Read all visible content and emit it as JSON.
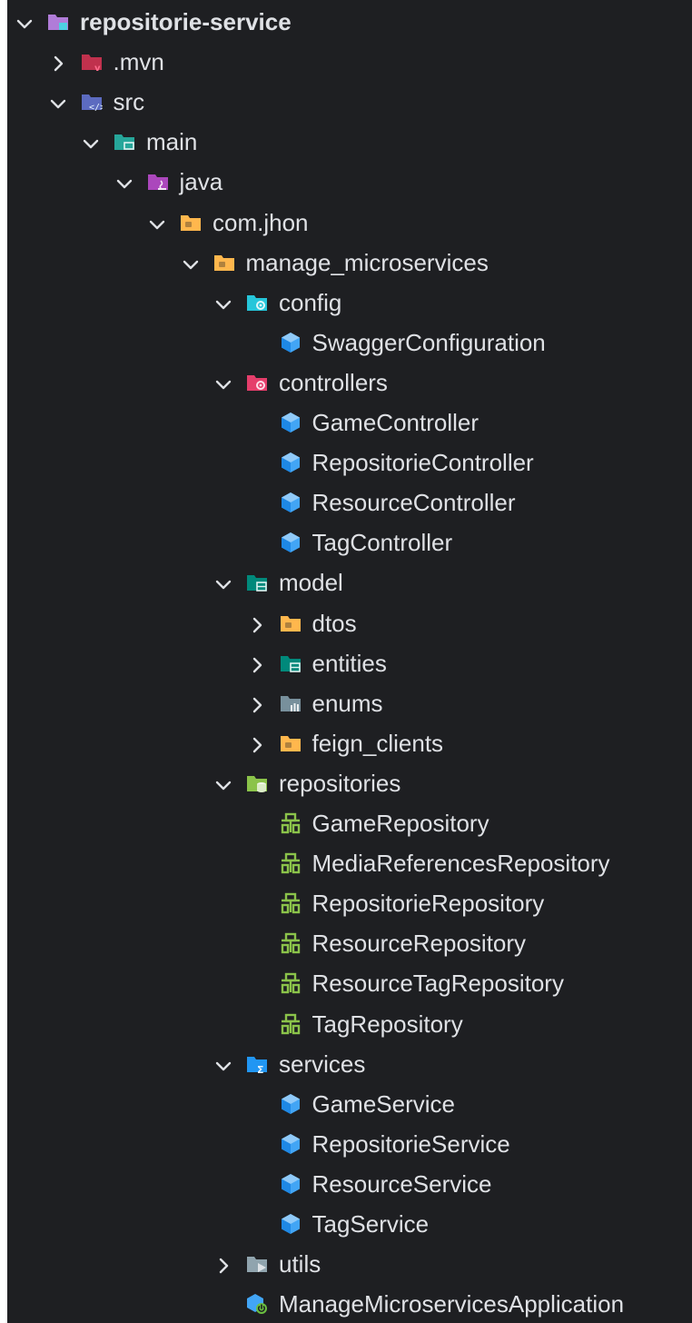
{
  "tree": {
    "nodes": [
      {
        "label": "repositorie-service",
        "depth": 0,
        "state": "open",
        "icon": "module-folder-icon",
        "color": "#b07cd8",
        "bold": true
      },
      {
        "label": ".mvn",
        "depth": 1,
        "state": "closed",
        "icon": "maven-folder-icon",
        "color": "#c0314d"
      },
      {
        "label": "src",
        "depth": 1,
        "state": "open",
        "icon": "source-folder-icon",
        "color": "#5c6bc0"
      },
      {
        "label": "main",
        "depth": 2,
        "state": "open",
        "icon": "main-folder-icon",
        "color": "#26a69a"
      },
      {
        "label": "java",
        "depth": 3,
        "state": "open",
        "icon": "java-folder-icon",
        "color": "#ab47bc"
      },
      {
        "label": "com.jhon",
        "depth": 4,
        "state": "open",
        "icon": "package-folder-icon",
        "color": "#ffb74d"
      },
      {
        "label": "manage_microservices",
        "depth": 5,
        "state": "open",
        "icon": "package-folder-icon",
        "color": "#ffb74d"
      },
      {
        "label": "config",
        "depth": 6,
        "state": "open",
        "icon": "config-folder-icon",
        "color": "#26c6da"
      },
      {
        "label": "SwaggerConfiguration",
        "depth": 7,
        "state": "leaf",
        "icon": "class-icon",
        "color": "#42a5f5"
      },
      {
        "label": "controllers",
        "depth": 6,
        "state": "open",
        "icon": "controllers-folder-icon",
        "color": "#e53e6b"
      },
      {
        "label": "GameController",
        "depth": 7,
        "state": "leaf",
        "icon": "class-icon",
        "color": "#42a5f5"
      },
      {
        "label": "RepositorieController",
        "depth": 7,
        "state": "leaf",
        "icon": "class-icon",
        "color": "#42a5f5"
      },
      {
        "label": "ResourceController",
        "depth": 7,
        "state": "leaf",
        "icon": "class-icon",
        "color": "#42a5f5"
      },
      {
        "label": "TagController",
        "depth": 7,
        "state": "leaf",
        "icon": "class-icon",
        "color": "#42a5f5"
      },
      {
        "label": "model",
        "depth": 6,
        "state": "open",
        "icon": "model-folder-icon",
        "color": "#00897b"
      },
      {
        "label": "dtos",
        "depth": 7,
        "state": "closed",
        "icon": "package-folder-icon",
        "color": "#ffb74d"
      },
      {
        "label": "entities",
        "depth": 7,
        "state": "closed",
        "icon": "model-folder-icon",
        "color": "#00897b"
      },
      {
        "label": "enums",
        "depth": 7,
        "state": "closed",
        "icon": "enums-folder-icon",
        "color": "#78909c"
      },
      {
        "label": "feign_clients",
        "depth": 7,
        "state": "closed",
        "icon": "package-folder-icon",
        "color": "#ffb74d"
      },
      {
        "label": "repositories",
        "depth": 6,
        "state": "open",
        "icon": "repositories-folder-icon",
        "color": "#8bc34a"
      },
      {
        "label": "GameRepository",
        "depth": 7,
        "state": "leaf",
        "icon": "interface-icon",
        "color": "#8bc34a"
      },
      {
        "label": "MediaReferencesRepository",
        "depth": 7,
        "state": "leaf",
        "icon": "interface-icon",
        "color": "#8bc34a"
      },
      {
        "label": "RepositorieRepository",
        "depth": 7,
        "state": "leaf",
        "icon": "interface-icon",
        "color": "#8bc34a"
      },
      {
        "label": "ResourceRepository",
        "depth": 7,
        "state": "leaf",
        "icon": "interface-icon",
        "color": "#8bc34a"
      },
      {
        "label": "ResourceTagRepository",
        "depth": 7,
        "state": "leaf",
        "icon": "interface-icon",
        "color": "#8bc34a"
      },
      {
        "label": "TagRepository",
        "depth": 7,
        "state": "leaf",
        "icon": "interface-icon",
        "color": "#8bc34a"
      },
      {
        "label": "services",
        "depth": 6,
        "state": "open",
        "icon": "services-folder-icon",
        "color": "#2196f3"
      },
      {
        "label": "GameService",
        "depth": 7,
        "state": "leaf",
        "icon": "class-icon",
        "color": "#42a5f5"
      },
      {
        "label": "RepositorieService",
        "depth": 7,
        "state": "leaf",
        "icon": "class-icon",
        "color": "#42a5f5"
      },
      {
        "label": "ResourceService",
        "depth": 7,
        "state": "leaf",
        "icon": "class-icon",
        "color": "#42a5f5"
      },
      {
        "label": "TagService",
        "depth": 7,
        "state": "leaf",
        "icon": "class-icon",
        "color": "#42a5f5"
      },
      {
        "label": "utils",
        "depth": 6,
        "state": "closed",
        "icon": "utils-folder-icon",
        "color": "#90a4ae"
      },
      {
        "label": "ManageMicroservicesApplication",
        "depth": 6,
        "state": "leaf",
        "icon": "spring-boot-app-icon",
        "color": "#42a5f5"
      }
    ]
  }
}
